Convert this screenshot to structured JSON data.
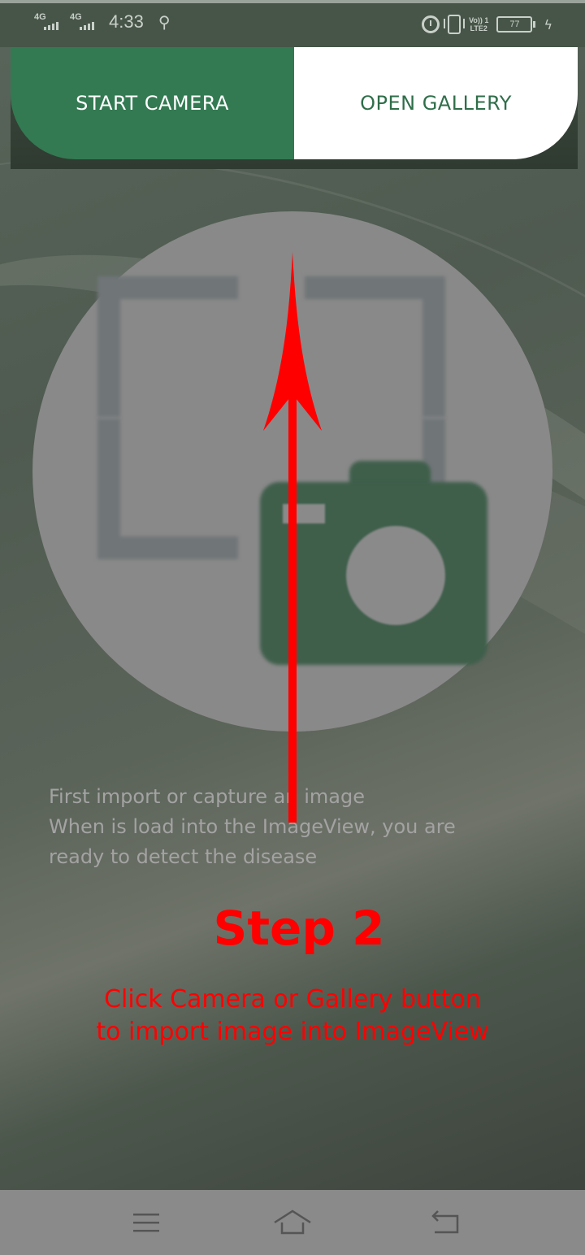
{
  "status_bar": {
    "network_1": "4G",
    "network_2": "4G",
    "time": "4:33",
    "volte_line1": "Vo)) 1",
    "volte_line2": "LTE2",
    "battery_level": "77"
  },
  "buttons": {
    "start_camera": "START CAMERA",
    "open_gallery": "OPEN GALLERY"
  },
  "instructions": {
    "line1": "First import or capture an image",
    "line2": "When is load into the ImageView, you are",
    "line3": "ready to detect the disease"
  },
  "annotation": {
    "title": "Step 2",
    "line1": "Click Camera or Gallery button",
    "line2": "to import image into ImageView",
    "color": "#ff0000"
  },
  "colors": {
    "camera_button": "#337a52",
    "gallery_text": "#2f6e4a",
    "image_view_bg": "#898989"
  },
  "nav_bar": {
    "icons": [
      "menu-icon",
      "home-icon",
      "back-icon"
    ]
  }
}
